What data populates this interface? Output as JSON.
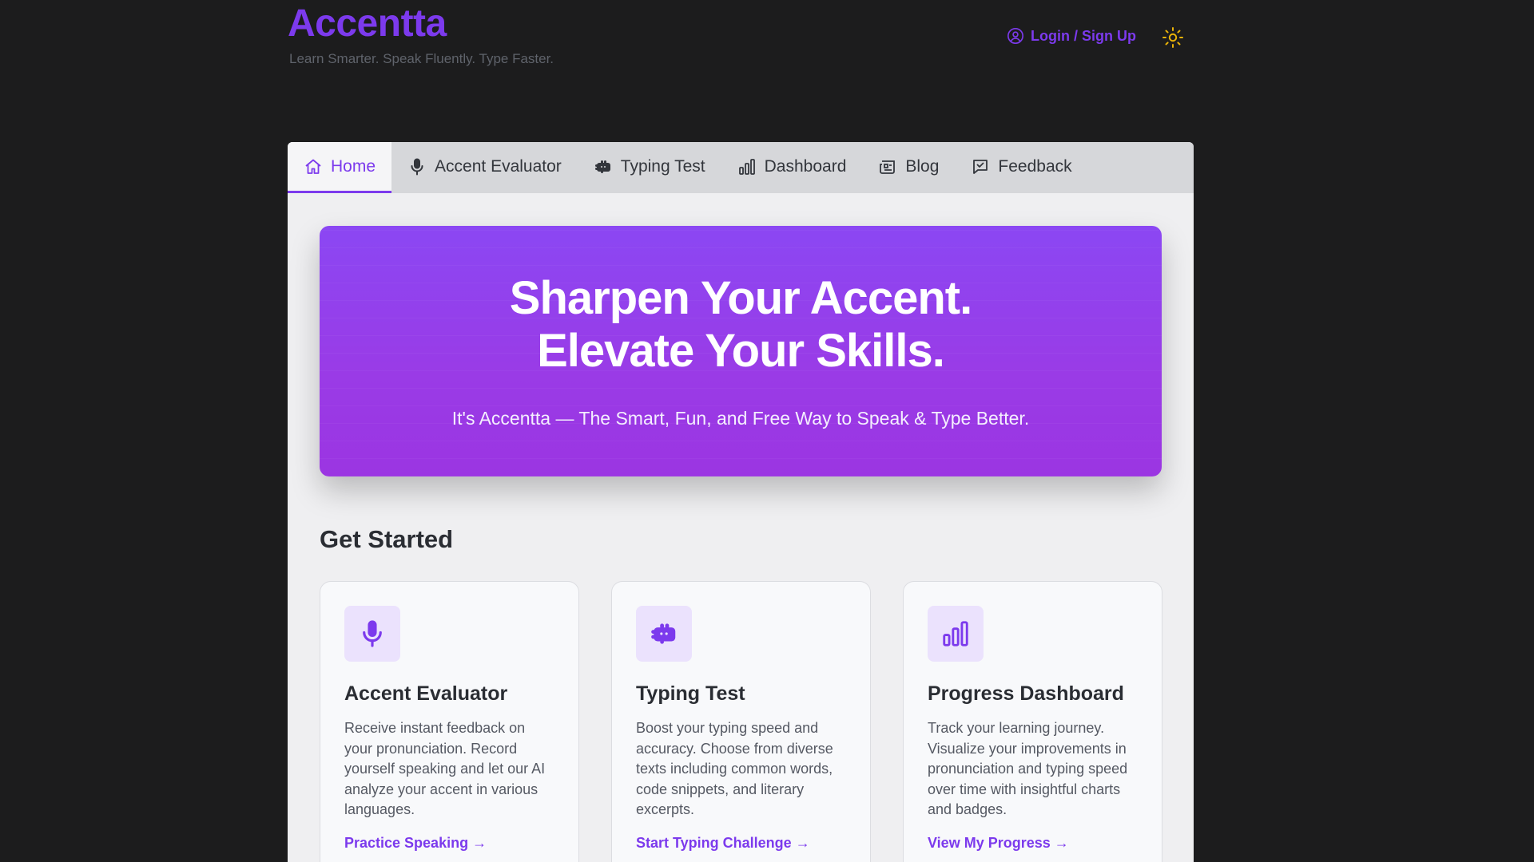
{
  "header": {
    "logo": "Accentta",
    "tagline": "Learn Smarter. Speak Fluently. Type Faster.",
    "login_label": "Login / Sign Up",
    "theme_icon": "sun-icon"
  },
  "nav": {
    "items": [
      {
        "label": "Home",
        "icon": "home-icon",
        "active": true
      },
      {
        "label": "Accent Evaluator",
        "icon": "microphone-icon"
      },
      {
        "label": "Typing Test",
        "icon": "keyboard-icon"
      },
      {
        "label": "Dashboard",
        "icon": "bar-chart-icon"
      },
      {
        "label": "Blog",
        "icon": "newspaper-icon"
      },
      {
        "label": "Feedback",
        "icon": "message-icon"
      }
    ]
  },
  "hero": {
    "title_line1": "Sharpen Your Accent.",
    "title_line2": "Elevate Your Skills.",
    "subtitle": "It's Accentta — The Smart, Fun, and Free Way to Speak & Type Better."
  },
  "get_started": {
    "title": "Get Started",
    "cards": [
      {
        "icon": "microphone-icon",
        "title": "Accent Evaluator",
        "description": "Receive instant feedback on your pronunciation. Record yourself speaking and let our AI analyze your accent in various languages.",
        "link": "Practice Speaking →"
      },
      {
        "icon": "keyboard-icon",
        "title": "Typing Test",
        "description": "Boost your typing speed and accuracy. Choose from diverse texts including common words, code snippets, and literary excerpts.",
        "link": "Start Typing Challenge →"
      },
      {
        "icon": "bar-chart-icon",
        "title": "Progress Dashboard",
        "description": "Track your learning journey. Visualize your improvements in pronunciation and typing speed over time with insightful charts and badges.",
        "link": "View My Progress →"
      }
    ]
  },
  "colors": {
    "accent": "#7c3aed",
    "background": "#1c1c1d",
    "panel": "#efeff1",
    "sun": "#eab308"
  }
}
